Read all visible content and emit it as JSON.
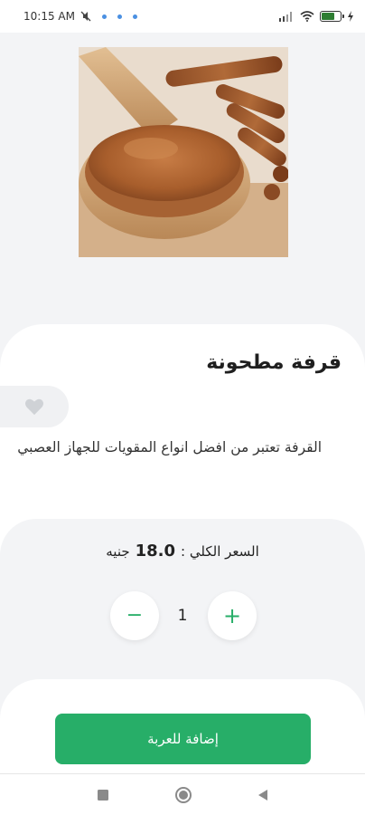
{
  "status_bar": {
    "time": "10:15 AM"
  },
  "product": {
    "name": "قرفة مطحونة",
    "description": "القرفة تعتبر من افضل انواع المقويات للجهاز العصبي",
    "image_icon": "cinnamon-photo"
  },
  "price": {
    "label": "السعر الكلي :",
    "value": "18.0",
    "currency": "جنيه"
  },
  "quantity": {
    "value": "1",
    "minus_symbol": "−",
    "plus_symbol": "+"
  },
  "actions": {
    "add_to_cart_label": "إضافة للعربة"
  },
  "colors": {
    "primary": "#27ae68",
    "background": "#f3f4f6",
    "card": "#ffffff"
  }
}
